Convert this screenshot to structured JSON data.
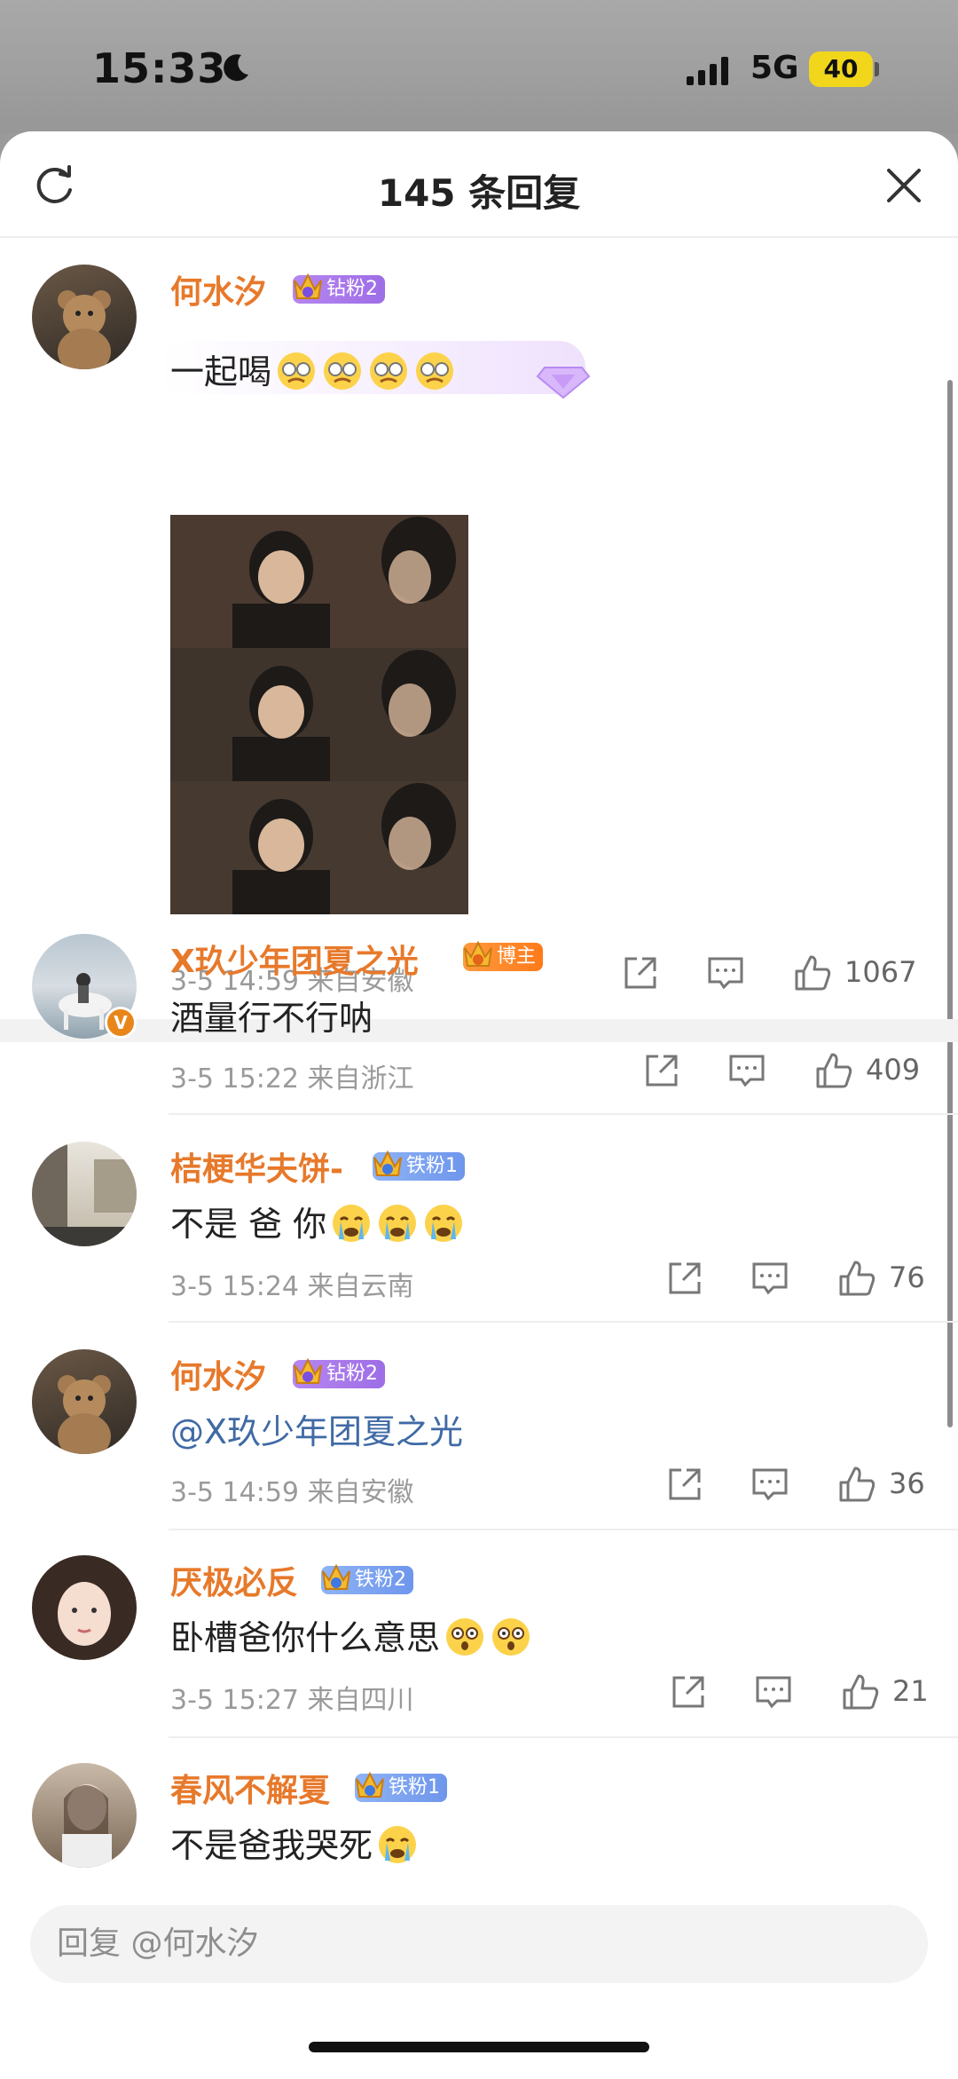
{
  "status_bar": {
    "time": "15:33",
    "network": "5G",
    "battery": "40"
  },
  "header": {
    "title": "145 条回复"
  },
  "main_comment": {
    "username": "何水汐",
    "badge": "钻粉2",
    "text": "一起喝",
    "meta": "3-5 14:59  来自安徽",
    "likes": "1067"
  },
  "replies": [
    {
      "username": "X玖少年团夏之光",
      "badge": "博主",
      "text": "酒量行不行呐",
      "meta": "3-5 15:22  来自浙江",
      "likes": "409"
    },
    {
      "username": "桔梗华夫饼-",
      "badge": "铁粉1",
      "text": "不是 爸 你",
      "meta": "3-5 15:24  来自云南",
      "likes": "76"
    },
    {
      "username": "何水汐",
      "badge": "钻粉2",
      "text": "@X玖少年团夏之光",
      "meta": "3-5 14:59  来自安徽",
      "likes": "36"
    },
    {
      "username": "厌极必反",
      "badge": "铁粉2",
      "text": "卧槽爸你什么意思",
      "meta": "3-5 15:27  来自四川",
      "likes": "21"
    },
    {
      "username": "春风不解夏",
      "badge": "铁粉1",
      "text": "不是爸我哭死"
    }
  ],
  "reply_input": {
    "placeholder": "回复 @何水汐"
  },
  "colors": {
    "username": "#e7792b",
    "mention": "#3f6aa5",
    "meta": "#9a9a9a"
  }
}
